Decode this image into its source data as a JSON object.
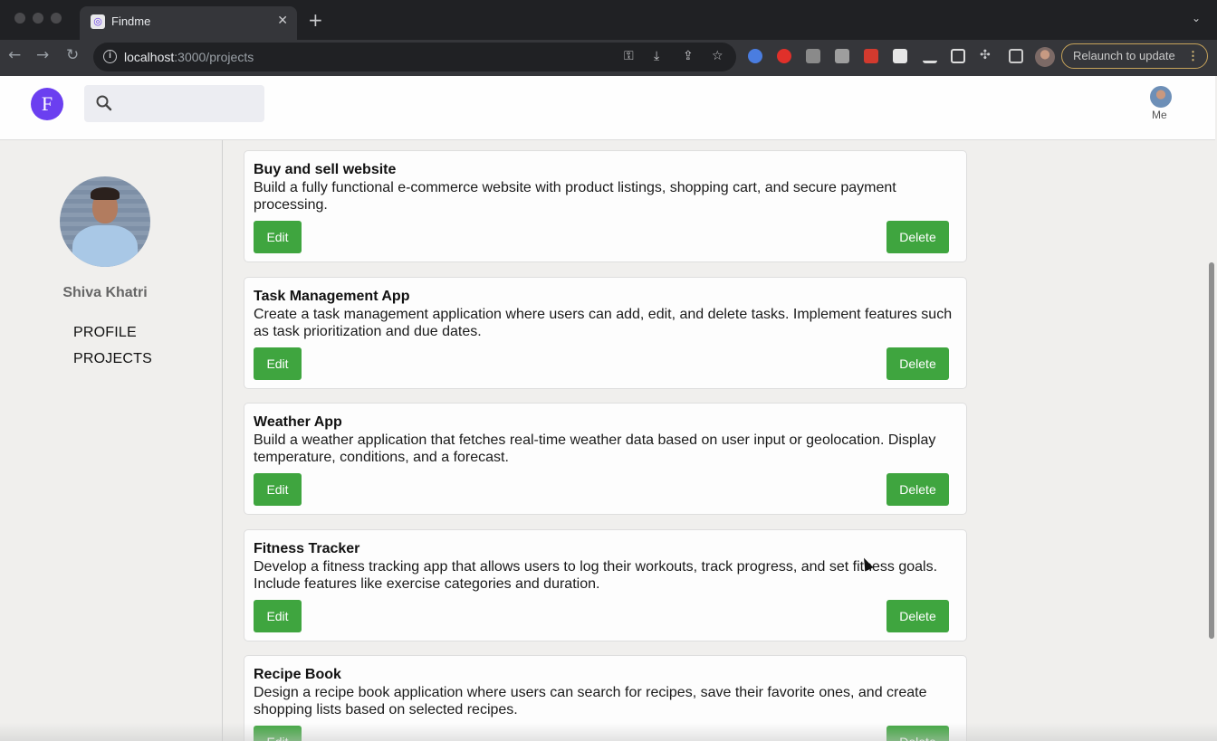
{
  "browser": {
    "tab_title": "Findme",
    "tab_close": "✕",
    "new_tab": "+",
    "tab_menu": "⌄",
    "url_host": "localhost",
    "url_path": ":3000/projects",
    "relaunch_label": "Relaunch to update",
    "relaunch_menu": "⋮",
    "accent": "#c6a35a"
  },
  "header": {
    "logo_letter": "F",
    "search_placeholder": "",
    "me_label": "Me"
  },
  "sidebar": {
    "name": "Shiva Khatri",
    "nav": [
      {
        "label": "PROFILE"
      },
      {
        "label": "PROJECTS"
      }
    ]
  },
  "projects": [
    {
      "title": "Buy and sell website",
      "description": "Build a fully functional e-commerce website with product listings, shopping cart, and secure payment processing.",
      "edit_label": "Edit",
      "delete_label": "Delete"
    },
    {
      "title": "Task Management App",
      "description": "Create a task management application where users can add, edit, and delete tasks. Implement features such as task prioritization and due dates.",
      "edit_label": "Edit",
      "delete_label": "Delete"
    },
    {
      "title": "Weather App",
      "description": "Build a weather application that fetches real-time weather data based on user input or geolocation. Display temperature, conditions, and a forecast.",
      "edit_label": "Edit",
      "delete_label": "Delete"
    },
    {
      "title": "Fitness Tracker",
      "description": "Develop a fitness tracking app that allows users to log their workouts, track progress, and set fitness goals. Include features like exercise categories and duration.",
      "edit_label": "Edit",
      "delete_label": "Delete"
    },
    {
      "title": "Recipe Book",
      "description": "Design a recipe book application where users can search for recipes, save their favorite ones, and create shopping lists based on selected recipes.",
      "edit_label": "Edit",
      "delete_label": "Delete"
    }
  ],
  "colors": {
    "button_green": "#3fa53f",
    "logo_purple": "#6b3ff0"
  }
}
